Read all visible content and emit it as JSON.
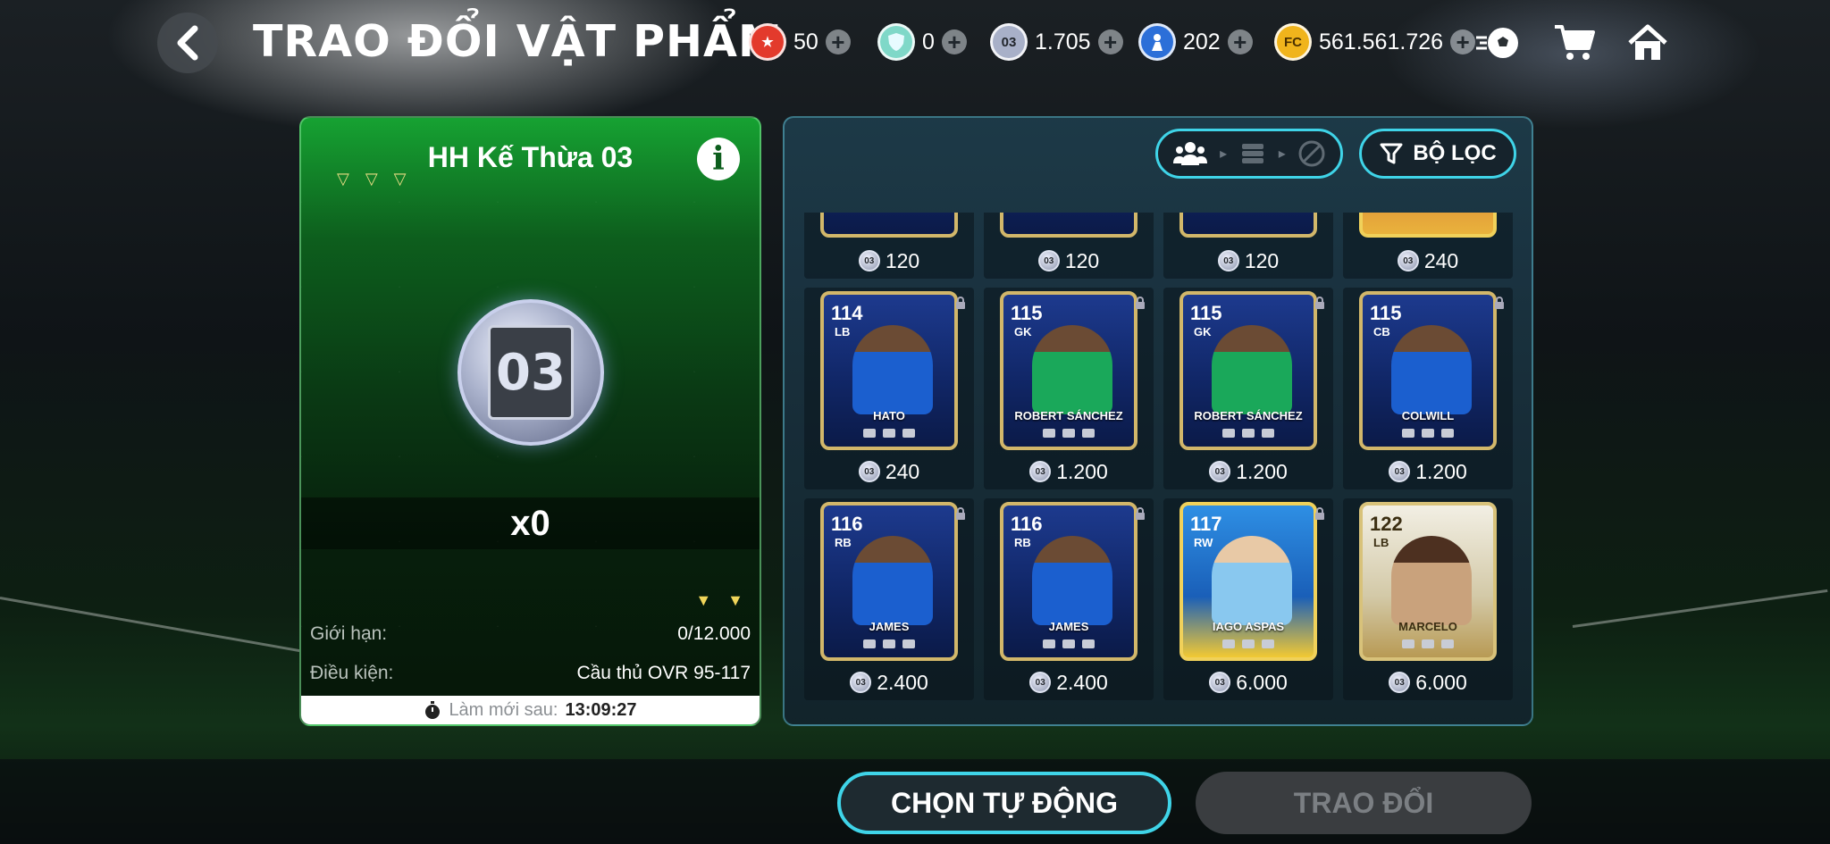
{
  "header": {
    "title": "TRAO ĐỔI VẬT PHẨM",
    "currencies": [
      {
        "name": "badge-currency",
        "value": "50",
        "color": "#e33a2c"
      },
      {
        "name": "shield-currency",
        "value": "0",
        "color": "#7fd8c8"
      },
      {
        "name": "token-03-currency",
        "value": "1.705",
        "color": "#a8b0c8"
      },
      {
        "name": "player-currency",
        "value": "202",
        "color": "#2c6fd8"
      },
      {
        "name": "fc-points-currency",
        "value": "561.561.726",
        "color": "#f0b41c"
      }
    ]
  },
  "item": {
    "title": "HH Kế Thừa 03",
    "coin_label": "03",
    "count": "x0",
    "limit_label": "Giới hạn:",
    "limit_value": "0/12.000",
    "condition_label": "Điều kiện:",
    "condition_value": "Cầu thủ OVR 95-117",
    "refresh_label": "Làm mới sau:",
    "refresh_value": "13:09:27"
  },
  "filter": {
    "label": "BỘ LỌC"
  },
  "grid": {
    "top_row_prices": [
      "120",
      "120",
      "120",
      "240"
    ],
    "cards": [
      {
        "ovr": "114",
        "pos": "LB",
        "name": "HATO",
        "price": "240",
        "style": "normal"
      },
      {
        "ovr": "115",
        "pos": "GK",
        "name": "ROBERT SÁNCHEZ",
        "price": "1.200",
        "style": "gk"
      },
      {
        "ovr": "115",
        "pos": "GK",
        "name": "ROBERT SÁNCHEZ",
        "price": "1.200",
        "style": "gk"
      },
      {
        "ovr": "115",
        "pos": "CB",
        "name": "COLWILL",
        "price": "1.200",
        "style": "normal"
      },
      {
        "ovr": "116",
        "pos": "RB",
        "name": "JAMES",
        "price": "2.400",
        "style": "normal"
      },
      {
        "ovr": "116",
        "pos": "RB",
        "name": "JAMES",
        "price": "2.400",
        "style": "normal"
      },
      {
        "ovr": "117",
        "pos": "RW",
        "name": "IAGO ASPAS",
        "price": "6.000",
        "style": "toty"
      },
      {
        "ovr": "122",
        "pos": "LB",
        "name": "MARCELO",
        "price": "6.000",
        "style": "icon"
      }
    ]
  },
  "actions": {
    "auto_label": "CHỌN TỰ ĐỘNG",
    "trade_label": "TRAO ĐỔI"
  }
}
